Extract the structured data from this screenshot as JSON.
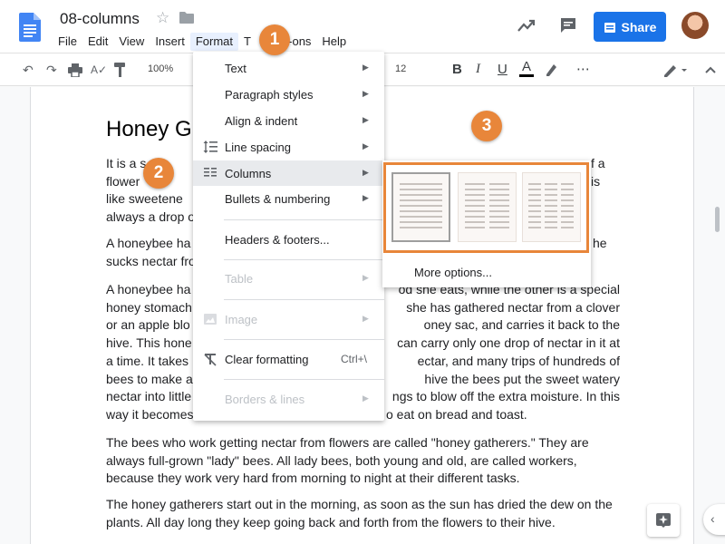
{
  "titlebar": {
    "doc_title": "08-columns",
    "share_label": "Share"
  },
  "menubar": [
    "File",
    "Edit",
    "View",
    "Insert",
    "Format",
    "T",
    "Add-ons",
    "Help"
  ],
  "toolbar": {
    "zoom": "100%",
    "font_size": "12",
    "bold": "B",
    "italic": "I",
    "underline": "U",
    "text_color": "A",
    "more": "⋯"
  },
  "document": {
    "heading": "Honey G",
    "paragraphs": [
      {
        "lines": [
          "It is a s",
          "flower",
          "like sweetene",
          "always a drop o"
        ],
        "right": [
          "f a",
          "is",
          "",
          ""
        ]
      },
      {
        "lines": [
          "A honeybee ha",
          "sucks nectar fro"
        ],
        "right": [
          "he",
          ""
        ]
      },
      {
        "lines": [
          "A honeybee ha",
          "honey stomach",
          "or an apple blo",
          "hive. This hone",
          "a time. It takes",
          "bees to make a",
          "nectar into little",
          "way it becomes"
        ],
        "right": [
          "od she eats, while the other is a special",
          "she has gathered nectar from a clover",
          "oney sac, and carries it back to the",
          "can carry only one drop of nectar in it at",
          "ectar, and many trips of hundreds of",
          "hive the bees put the sweet watery",
          "ngs to blow off the extra moisture. In this",
          "o eat on bread and toast."
        ]
      },
      {
        "text": "The bees who work getting nectar from flowers are called \"honey gatherers.\" They are always full-grown \"lady\" bees. All lady bees, both young and old, are called workers, because they work very hard from morning to night at their different tasks."
      },
      {
        "text": "The honey gatherers start out in the morning, as soon as the sun has dried the dew on the plants. All day long they keep going back and forth from the flowers to their hive."
      }
    ]
  },
  "format_menu": {
    "items": [
      {
        "label": "Text",
        "arrow": "▶"
      },
      {
        "label": "Paragraph styles",
        "arrow": "▶"
      },
      {
        "label": "Align & indent",
        "arrow": "▶"
      },
      {
        "label": "Line spacing",
        "arrow": "▶"
      },
      {
        "label": "Columns",
        "arrow": "▶"
      },
      {
        "label": "Bullets & numbering",
        "arrow": "▶"
      },
      {
        "label": "Headers & footers..."
      },
      {
        "label": "Table",
        "arrow": "▶"
      },
      {
        "label": "Image",
        "arrow": "▶"
      },
      {
        "label": "Clear formatting",
        "shortcut": "Ctrl+\\"
      },
      {
        "label": "Borders & lines",
        "arrow": "▶"
      }
    ]
  },
  "columns_submenu": {
    "options": [
      "one-column",
      "two-columns",
      "three-columns"
    ],
    "more_options": "More options..."
  },
  "callouts": [
    "1",
    "2",
    "3"
  ],
  "colors": {
    "accent": "#e8863a",
    "share_blue": "#1a73e8",
    "menu_highlight": "#e8eaed"
  }
}
